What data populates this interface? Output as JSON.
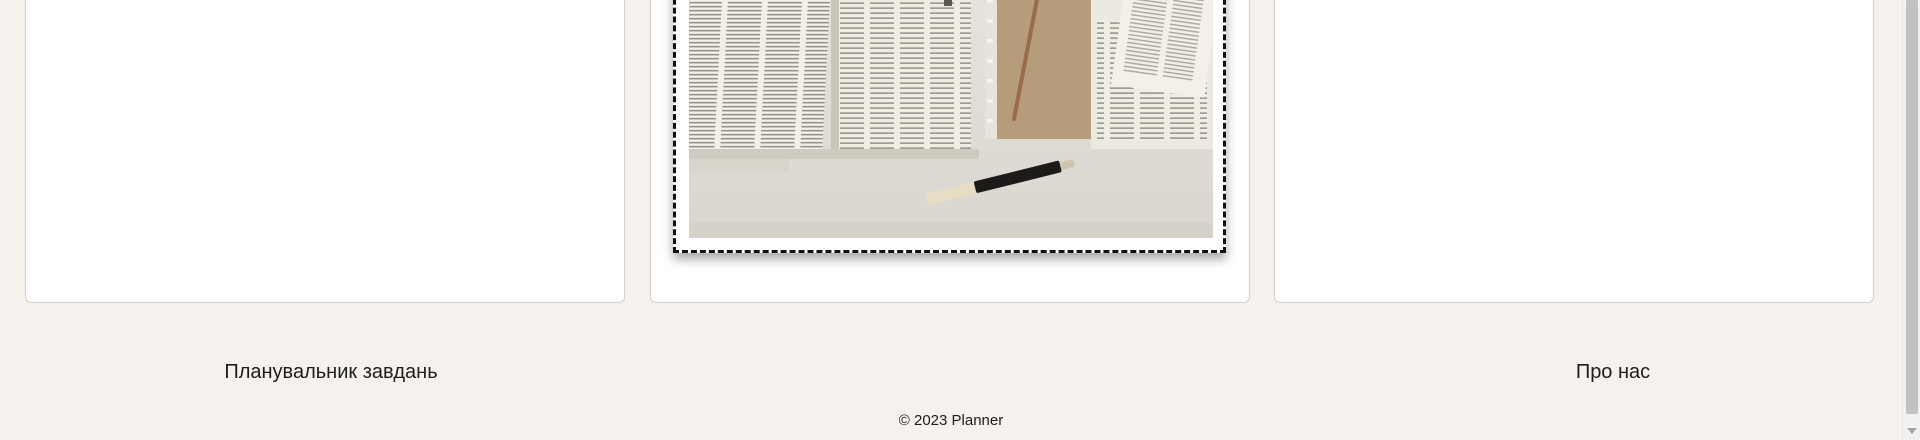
{
  "photo": {
    "alt": "Open books, notebook, pencil and pen on a table"
  },
  "footer": {
    "left_link": "Планувальник завдань",
    "right_link": "Про нас",
    "copyright": "© 2023 Planner"
  },
  "colors": {
    "page_bg": "#f5f2ed",
    "card_bg": "#ffffff",
    "card_border": "#d2d0cc",
    "frame_border": "#111111",
    "text": "#1d1d1d"
  }
}
